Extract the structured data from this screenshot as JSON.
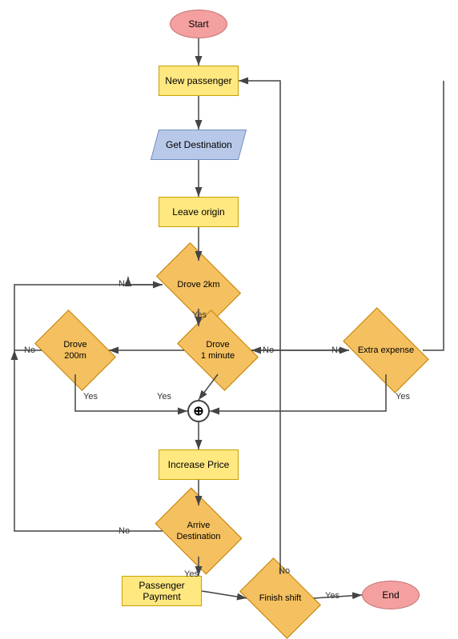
{
  "nodes": {
    "start": {
      "label": "Start"
    },
    "new_passenger": {
      "label": "New passenger"
    },
    "get_destination": {
      "label": "Get Destination"
    },
    "leave_origin": {
      "label": "Leave origin"
    },
    "drove_2km": {
      "label": "Drove 2km"
    },
    "drove_200m": {
      "label": "Drove\n200m"
    },
    "drove_1min": {
      "label": "Drove\n1 minute"
    },
    "extra_expense": {
      "label": "Extra expense"
    },
    "increase_price": {
      "label": "Increase Price"
    },
    "arrive_destination": {
      "label": "Arrive\nDestination"
    },
    "passenger_payment": {
      "label": "Passenger\nPayment"
    },
    "finish_shift": {
      "label": "Finish shift"
    },
    "end": {
      "label": "End"
    }
  },
  "labels": {
    "yes": "Yes",
    "no": "No"
  }
}
